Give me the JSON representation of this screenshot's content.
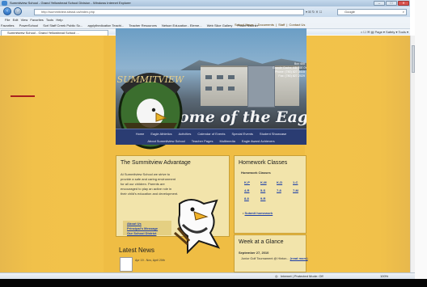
{
  "browser": {
    "window_title": "Summitview School - Grand Yellowhead School Division - Windows Internet Explorer",
    "window_buttons": [
      "–",
      "□",
      "✕"
    ],
    "address_url": "http://summitview.sbssd.ca/index.php",
    "search_placeholder": "Google",
    "menu": [
      "File",
      "Edit",
      "View",
      "Favorites",
      "Tools",
      "Help"
    ],
    "favorites": [
      "Favorites",
      "PowerSchool",
      "Scrl Staff Creek Public Sc...",
      "applythedication Teachi...",
      "Teacher Resources",
      "Nelson Education - Eleme...",
      "Web Slice Gallery",
      "PowerTeacher"
    ],
    "tab_title": "Summitview School - Grand Yellowhead School ...",
    "command_bar": "Page ▾  Safety ▾  Tools ▾",
    "status_text": "Internet | Protected Mode: Off",
    "zoom": "100%"
  },
  "site": {
    "top_links": [
      "School News",
      "Documents",
      "Staff",
      "Contact Us"
    ],
    "logo_text": "SUMMITVIEW",
    "address": [
      "Box 400",
      "Grande Cache, AB T0E 0Y0",
      "Phone: (780) 827-3415",
      "Fax: (780) 827-2029"
    ],
    "banner_title": "Home of the Eagles",
    "nav_row1": [
      "Home",
      "Eagle Athletics",
      "Activities",
      "Calendar of Events",
      "Special Events",
      "Student Showcase"
    ],
    "nav_row2": [
      "About Summitview School",
      "Teacher Pages",
      "Multimedia",
      "Eagle Award Achievers"
    ],
    "advantage": {
      "title": "The Summitview Advantage",
      "body": "At Summitview School we strive to provide a safe and caring environment for all our children. Parents are encouraged to play an active role in their child's education and development.",
      "links": [
        "About Us",
        "Principal's Message",
        "Our School District"
      ]
    },
    "homework": {
      "title": "Homework Classes",
      "subtitle": "Homework Classes",
      "grades": [
        "K-P",
        "K-M",
        "K-D",
        "1-C",
        "4-R",
        "5-S",
        "7-8",
        "7-M",
        "8-8",
        "9-R"
      ],
      "submit": "Submit homework"
    },
    "week": {
      "title": "Week at a Glance",
      "date": "September 27, 2010",
      "event": "Junior Golf Tournament @ Hinton...",
      "more": "(read more)"
    },
    "latest_news": {
      "title": "Latest News",
      "date": "Apr 19 - Nov, April 20th"
    }
  },
  "colors": {
    "page_gold": "#f5c448",
    "nav_blue": "#2a3c72",
    "link_blue": "#1d3fa8"
  }
}
